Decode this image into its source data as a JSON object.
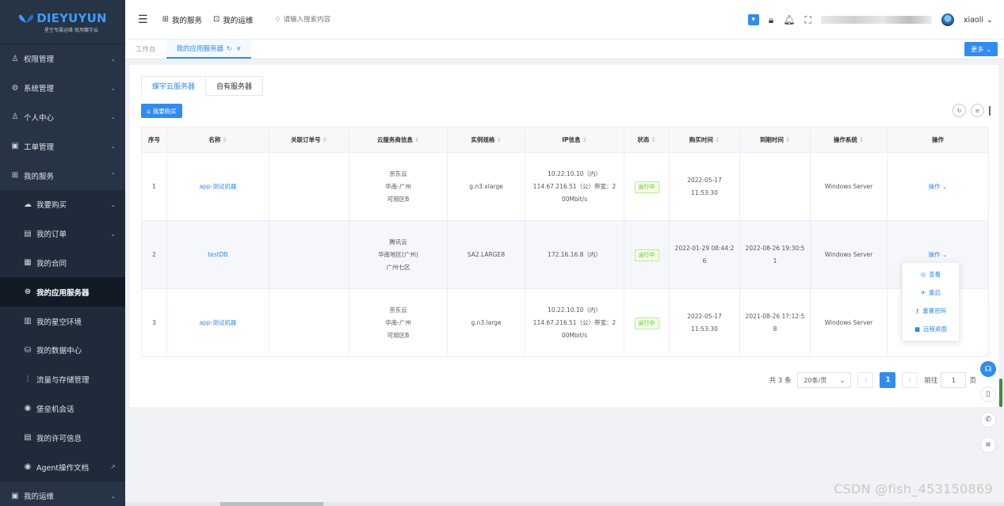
{
  "brand": {
    "name": "DIEYUYUN",
    "tagline": "星空专属运维 就用蝶宇云",
    "primary_color": "#2f8cf0",
    "sidebar_bg": "#263445"
  },
  "sidebar": {
    "items": [
      {
        "label": "权限管理",
        "icon": "user-icon",
        "glyph": "♙",
        "chevron": "⌄"
      },
      {
        "label": "系统管理",
        "icon": "gear-icon",
        "glyph": "⚙",
        "chevron": "⌄"
      },
      {
        "label": "个人中心",
        "icon": "person-icon",
        "glyph": "♙",
        "chevron": "⌄"
      },
      {
        "label": "工单管理",
        "icon": "ticket-icon",
        "glyph": "▣",
        "chevron": "⌄"
      },
      {
        "label": "我的服务",
        "icon": "grid-icon",
        "glyph": "⊞",
        "chevron": "⌃"
      },
      {
        "label": "我要购买",
        "icon": "cloud-icon",
        "glyph": "☁",
        "chevron": "⌄"
      },
      {
        "label": "我的订单",
        "icon": "order-icon",
        "glyph": "▤",
        "chevron": "⌄"
      },
      {
        "label": "我的合同",
        "icon": "contract-icon",
        "glyph": "▦",
        "chevron": ""
      },
      {
        "label": "我的应用服务器",
        "icon": "server-icon",
        "glyph": "⊜",
        "chevron": ""
      },
      {
        "label": "我的星空环境",
        "icon": "environment-icon",
        "glyph": "▥",
        "chevron": ""
      },
      {
        "label": "我的数据中心",
        "icon": "database-icon",
        "glyph": "⛁",
        "chevron": ""
      },
      {
        "label": "流量与存储管理",
        "icon": "traffic-icon",
        "glyph": "⫶",
        "chevron": ""
      },
      {
        "label": "堡垒机会话",
        "icon": "bastion-icon",
        "glyph": "◉",
        "chevron": ""
      },
      {
        "label": "我的许可信息",
        "icon": "license-icon",
        "glyph": "▤",
        "chevron": ""
      },
      {
        "label": "Agent操作文档",
        "icon": "doc-icon",
        "glyph": "◉",
        "chevron": "↗"
      },
      {
        "label": "我的运维",
        "icon": "ops-icon",
        "glyph": "▣",
        "chevron": "⌄"
      }
    ]
  },
  "header": {
    "nav": [
      {
        "label": "我的服务",
        "glyph": "⊞"
      },
      {
        "label": "我的运维",
        "glyph": "⊡"
      }
    ],
    "search_placeholder": "请输入搜索内容",
    "username": "xiaoli"
  },
  "page_tabs": {
    "workbench": "工作台",
    "current": "我的应用服务器",
    "more": "更多"
  },
  "content": {
    "server_tabs": [
      "蝶宇云服务器",
      "自有服务器"
    ],
    "buy_button": "我要购买",
    "columns": [
      "序号",
      "名称",
      "关联订单号",
      "云服务商信息",
      "实例规格",
      "IP信息",
      "状态",
      "购买时间",
      "到期时间",
      "操作系统",
      "操作"
    ],
    "rows": [
      {
        "no": "1",
        "name": "app-测试机器",
        "order": "",
        "provider": [
          "京东云",
          "华南-广州",
          "可用区B"
        ],
        "spec": "g.n3.xlarge",
        "ip": [
          "10.22.10.10（内）",
          "114.67.216.51（公）带宽：2",
          "00Mbit/s"
        ],
        "status": "运行中",
        "buy_time": "2022-05-17 11:53:30",
        "expire_time": "",
        "os": "Windows Server",
        "action": "操作 ⌄"
      },
      {
        "no": "2",
        "name": "testDB",
        "order": "",
        "provider": [
          "腾讯云",
          "华南地区(广州)",
          "广州七区"
        ],
        "spec": "SA2.LARGE8",
        "ip": [
          "172.16.16.8（内）"
        ],
        "status": "运行中",
        "buy_time": "2022-01-29 08:44:2 6",
        "expire_time": "2022-08-26 19:30:5 1",
        "os": "Windows Server",
        "action": "操作 ⌄"
      },
      {
        "no": "3",
        "name": "app-测试机器",
        "order": "",
        "provider": [
          "京东云",
          "华南-广州",
          "可用区B"
        ],
        "spec": "g.n3.large",
        "ip": [
          "10.22.10.10（内）",
          "114.67.216.51（公）带宽：2",
          "00Mbit/s"
        ],
        "status": "运行中",
        "buy_time": "2022-05-17 11:53:30",
        "expire_time": "2021-08-26 17:12:5 8",
        "os": "Windows Server",
        "action": ""
      }
    ],
    "dropdown": [
      {
        "label": "查看",
        "glyph": "◎"
      },
      {
        "label": "重启",
        "glyph": "✈"
      },
      {
        "label": "重置密码",
        "glyph": "⚷"
      },
      {
        "label": "远程桌面",
        "glyph": "■"
      }
    ],
    "pagination": {
      "total": "共 3 条",
      "page_size": "20条/页",
      "current_page": "1",
      "goto_label": "前往",
      "goto_value": "1",
      "page_suffix": "页"
    }
  },
  "watermark": "CSDN @fish_453150869"
}
